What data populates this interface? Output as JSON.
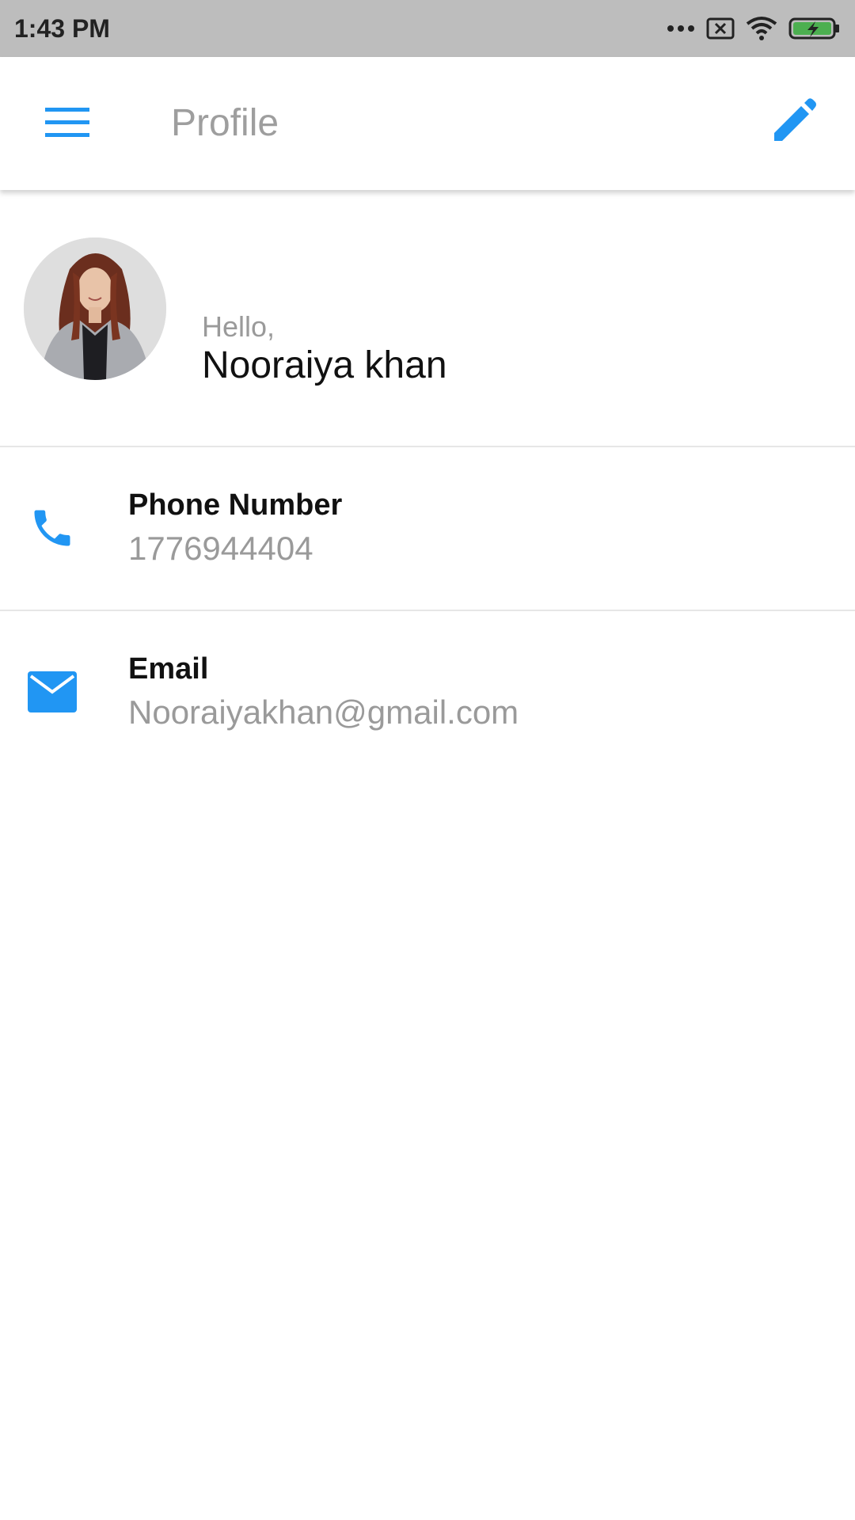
{
  "status_bar": {
    "time": "1:43 PM",
    "icons": [
      "more-dots-icon",
      "sim-no-signal-icon",
      "wifi-icon",
      "battery-charging-icon"
    ],
    "battery_color": "#4caf50"
  },
  "app_bar": {
    "title": "Profile",
    "menu_icon": "hamburger-menu-icon",
    "edit_icon": "pencil-edit-icon",
    "accent_color": "#2196f3"
  },
  "profile": {
    "greeting": "Hello,",
    "name": "Nooraiya khan"
  },
  "details": [
    {
      "icon": "phone-icon",
      "label": "Phone Number",
      "value": "1776944404"
    },
    {
      "icon": "email-icon",
      "label": "Email",
      "value": "Nooraiyakhan@gmail.com"
    }
  ]
}
